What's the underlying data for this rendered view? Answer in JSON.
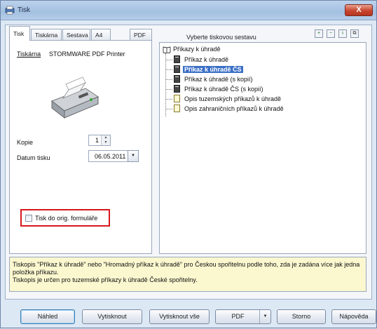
{
  "window": {
    "title": "Tisk",
    "close_symbol": "X",
    "icon": "print-app-icon"
  },
  "tabs": [
    "Tisk",
    "Tiskárna",
    "Sestava",
    "A4",
    "PDF"
  ],
  "print_panel": {
    "printer_label": "Tiskárna",
    "printer_name": "STORMWARE PDF Printer",
    "copies_label": "Kopie",
    "copies_value": "1",
    "date_label": "Datum tisku",
    "date_value": "06.05.2011",
    "orig_form_label": "Tisk do orig. formuláře",
    "orig_form_checked": false
  },
  "report_selector": {
    "label": "Vyberte tiskovou sestavu",
    "tool_icons": [
      "expand-icon",
      "collapse-icon",
      "info-icon",
      "copy-icon"
    ],
    "root": "Příkazy k úhradě",
    "items": [
      {
        "label": "Příkaz k úhradě",
        "icon": "dark-doc",
        "selected": false
      },
      {
        "label": "Příkaz k úhradě ČS",
        "icon": "dark-doc",
        "selected": true
      },
      {
        "label": "Příkaz k úhradě (s kopií)",
        "icon": "dark-doc",
        "selected": false
      },
      {
        "label": "Příkaz k úhradě ČS (s kopií)",
        "icon": "dark-doc",
        "selected": false
      },
      {
        "label": "Opis tuzemských příkazů k úhradě",
        "icon": "light-doc",
        "selected": false
      },
      {
        "label": "Opis zahraničních příkazů k úhradě",
        "icon": "light-doc",
        "selected": false
      }
    ]
  },
  "description": {
    "line1": "Tiskopis \"Příkaz k úhradě\" nebo \"Hromadný příkaz k úhradě\" pro Českou spořitelnu podle toho, zda je zadána více jak jedna položka příkazu.",
    "line2": "Tiskopis je určen pro tuzemské příkazy k úhradě České spořitelny."
  },
  "buttons": {
    "preview": "Náhled",
    "print": "Vytisknout",
    "print_all": "Vytisknout vše",
    "pdf": "PDF",
    "cancel": "Storno",
    "help": "Nápověda"
  },
  "colors": {
    "highlight": "#3b6fc6",
    "frame_red": "#d6181c",
    "desc_bg": "#fbf7cf"
  }
}
